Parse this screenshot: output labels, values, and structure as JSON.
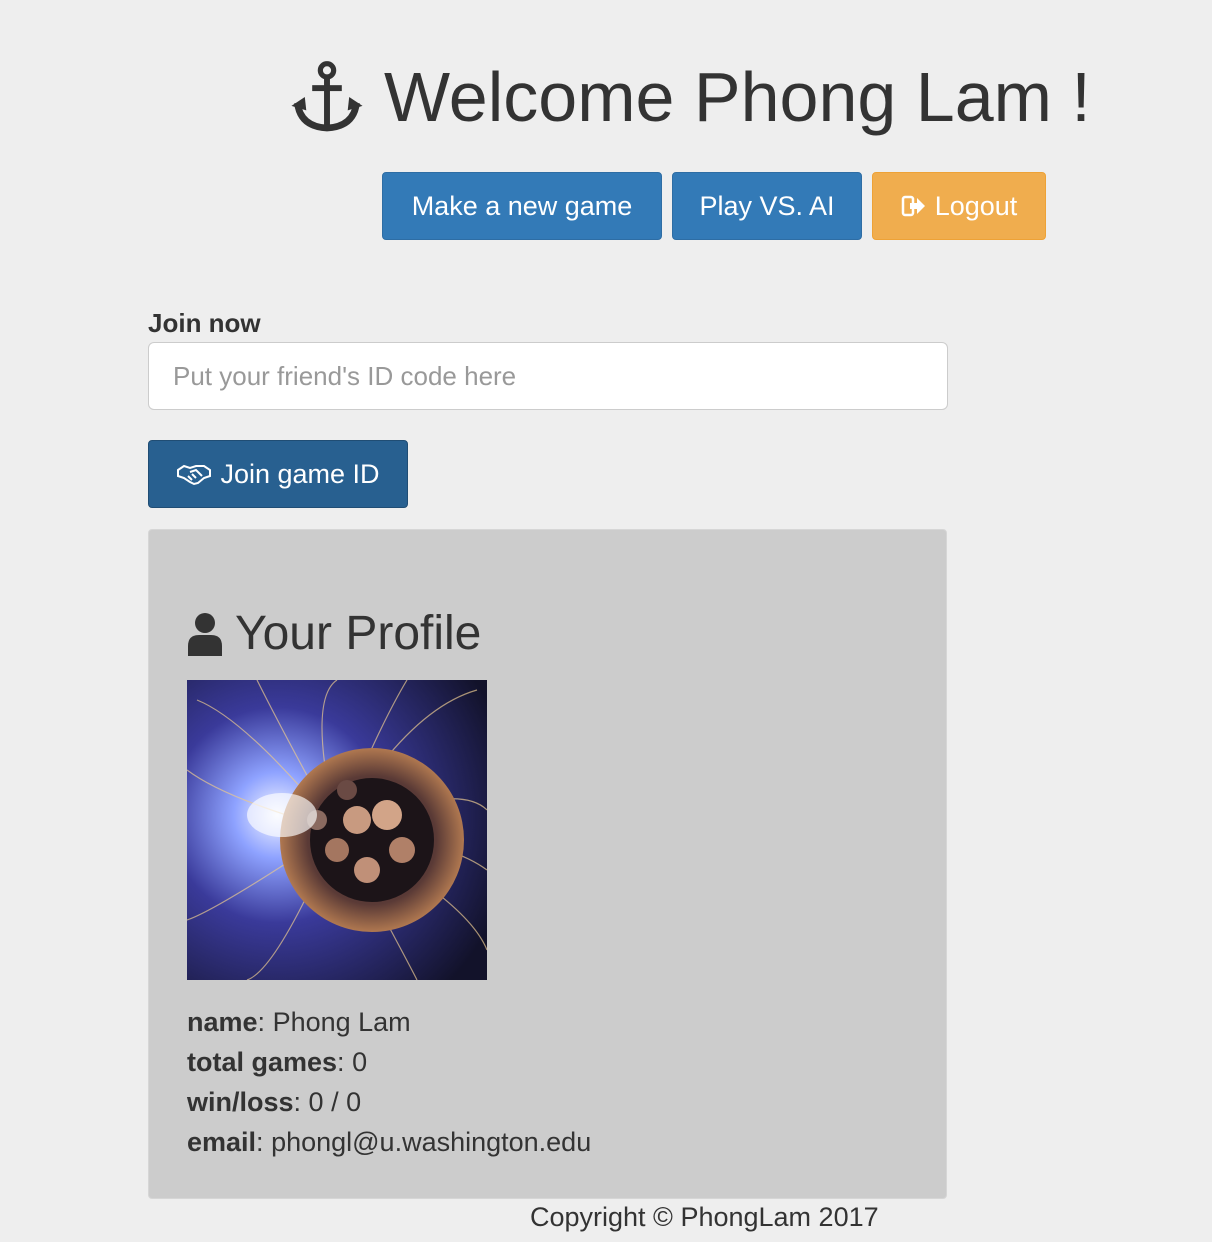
{
  "header": {
    "title": "Welcome Phong Lam !",
    "icon": "anchor-icon"
  },
  "actions": {
    "new_game_label": "Make a new game",
    "play_ai_label": "Play VS. AI",
    "logout_label": "Logout"
  },
  "join": {
    "label": "Join now",
    "placeholder": "Put your friend's ID code here",
    "value": "",
    "button_label": "Join game ID"
  },
  "profile": {
    "heading": "Your Profile",
    "fields": [
      {
        "key": "name",
        "value": "Phong Lam"
      },
      {
        "key": "total games",
        "value": "0"
      },
      {
        "key": "win/loss",
        "value": "0 / 0"
      },
      {
        "key": "email",
        "value": "phongl@u.washington.edu"
      }
    ]
  },
  "footer": {
    "copyright": "Copyright © PhongLam 2017"
  },
  "colors": {
    "primary": "#337ab7",
    "warning": "#f0ad4e",
    "dark_primary": "#286090",
    "background": "#eeeeee",
    "panel": "#cccccc"
  }
}
